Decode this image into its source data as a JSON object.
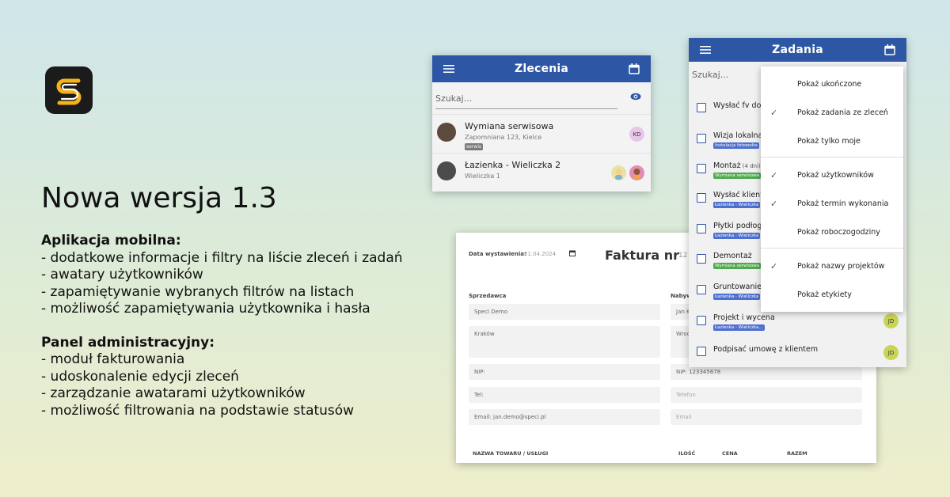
{
  "headline": "Nowa wersja 1.3",
  "mobile": {
    "heading": "Aplikacja mobilna:",
    "items": [
      "- dodatkowe informacje i filtry na liście zleceń i zadań",
      "- awatary użytkowników",
      "- zapamiętywanie wybranych filtrów na listach",
      "- możliwość zapamiętywania użytkownika i hasła"
    ]
  },
  "admin": {
    "heading": "Panel administracyjny:",
    "items": [
      "- moduł fakturowania",
      "- udoskonalenie edycji zleceń",
      "- zarządzanie awatarami użytkowników",
      "- możliwość filtrowania na podstawie statusów"
    ]
  },
  "zlecenia": {
    "title": "Zlecenia",
    "search_placeholder": "Szukaj...",
    "items": [
      {
        "name": "Wymiana serwisowa",
        "address": "Zapomniana 123, Kielce",
        "tag": "serwis",
        "users": [
          "KD"
        ]
      },
      {
        "name": "Łazienka - Wieliczka 2",
        "address": "Wieliczka 1",
        "tag": "",
        "users": [
          "",
          ""
        ]
      }
    ]
  },
  "faktura": {
    "date_label": "Data wystawienia:",
    "date_value": "21.04.2024",
    "title": "Faktura nr",
    "title_suffix": "12",
    "seller_label": "Sprzedawca",
    "buyer_label": "Nabyw",
    "seller": {
      "name": "Speci Demo",
      "address": "Kraków",
      "nip": "NIP:",
      "tel": "Tel:",
      "email": "Email: jan.demo@speci.pl"
    },
    "buyer": {
      "name": "Jan K",
      "address": "Wroc",
      "nip": "NIP:  123345678",
      "tel": "Telefon",
      "email": "Email"
    },
    "columns": [
      "NAZWA TOWARU / USŁUGI",
      "ILOŚĆ",
      "CENA",
      "RAZEM"
    ]
  },
  "zadania": {
    "title": "Zadania",
    "search_placeholder": "Szukaj...",
    "tasks": [
      {
        "text": "Wysłać fv do",
        "extra": "",
        "tag": "",
        "tag_color": "",
        "user": ""
      },
      {
        "text": "Wizja lokalna",
        "extra": "",
        "tag": "Instalacja fotowolta",
        "tag_color": "blue",
        "user": ""
      },
      {
        "text": "Montaż",
        "extra": "(4 dni)",
        "tag": "Wymiana serwisowa",
        "tag_color": "green",
        "user": ""
      },
      {
        "text": "Wysłać klient",
        "extra": "",
        "tag": "Łazienka - Wieliczka",
        "tag_color": "blue",
        "user": ""
      },
      {
        "text": "Płytki podłog",
        "extra": "",
        "tag": "Łazienka - Wieliczka",
        "tag_color": "blue",
        "user": ""
      },
      {
        "text": "Demontaż",
        "extra": "",
        "tag": "Wymiana serwisowa",
        "tag_color": "green",
        "user": ""
      },
      {
        "text": "Gruntowanie",
        "extra": "",
        "tag": "Łazienka - Wieliczka",
        "tag_color": "blue",
        "user": ""
      },
      {
        "text": "Projekt i wycena",
        "extra": "",
        "tag": "Łazienka - Wieliczka...",
        "tag_color": "blue",
        "user": "JD"
      },
      {
        "text": "Podpisać umowę z klientem",
        "extra": "",
        "tag": "",
        "tag_color": "",
        "user": "JD"
      }
    ],
    "menu": [
      {
        "label": "Pokaż ukończone",
        "checked": false
      },
      {
        "label": "Pokaż zadania ze zleceń",
        "checked": true
      },
      {
        "label": "Pokaż tylko moje",
        "checked": false
      },
      {
        "label": "Pokaż użytkowników",
        "checked": true
      },
      {
        "label": "Pokaż termin wykonania",
        "checked": true
      },
      {
        "label": "Pokaż roboczogodziny",
        "checked": false
      },
      {
        "label": "Pokaż nazwy projektów",
        "checked": true
      },
      {
        "label": "Pokaż etykiety",
        "checked": false
      }
    ]
  },
  "colors": {
    "appbar": "#2d57a4",
    "accent_yellow": "#f5b21a"
  }
}
